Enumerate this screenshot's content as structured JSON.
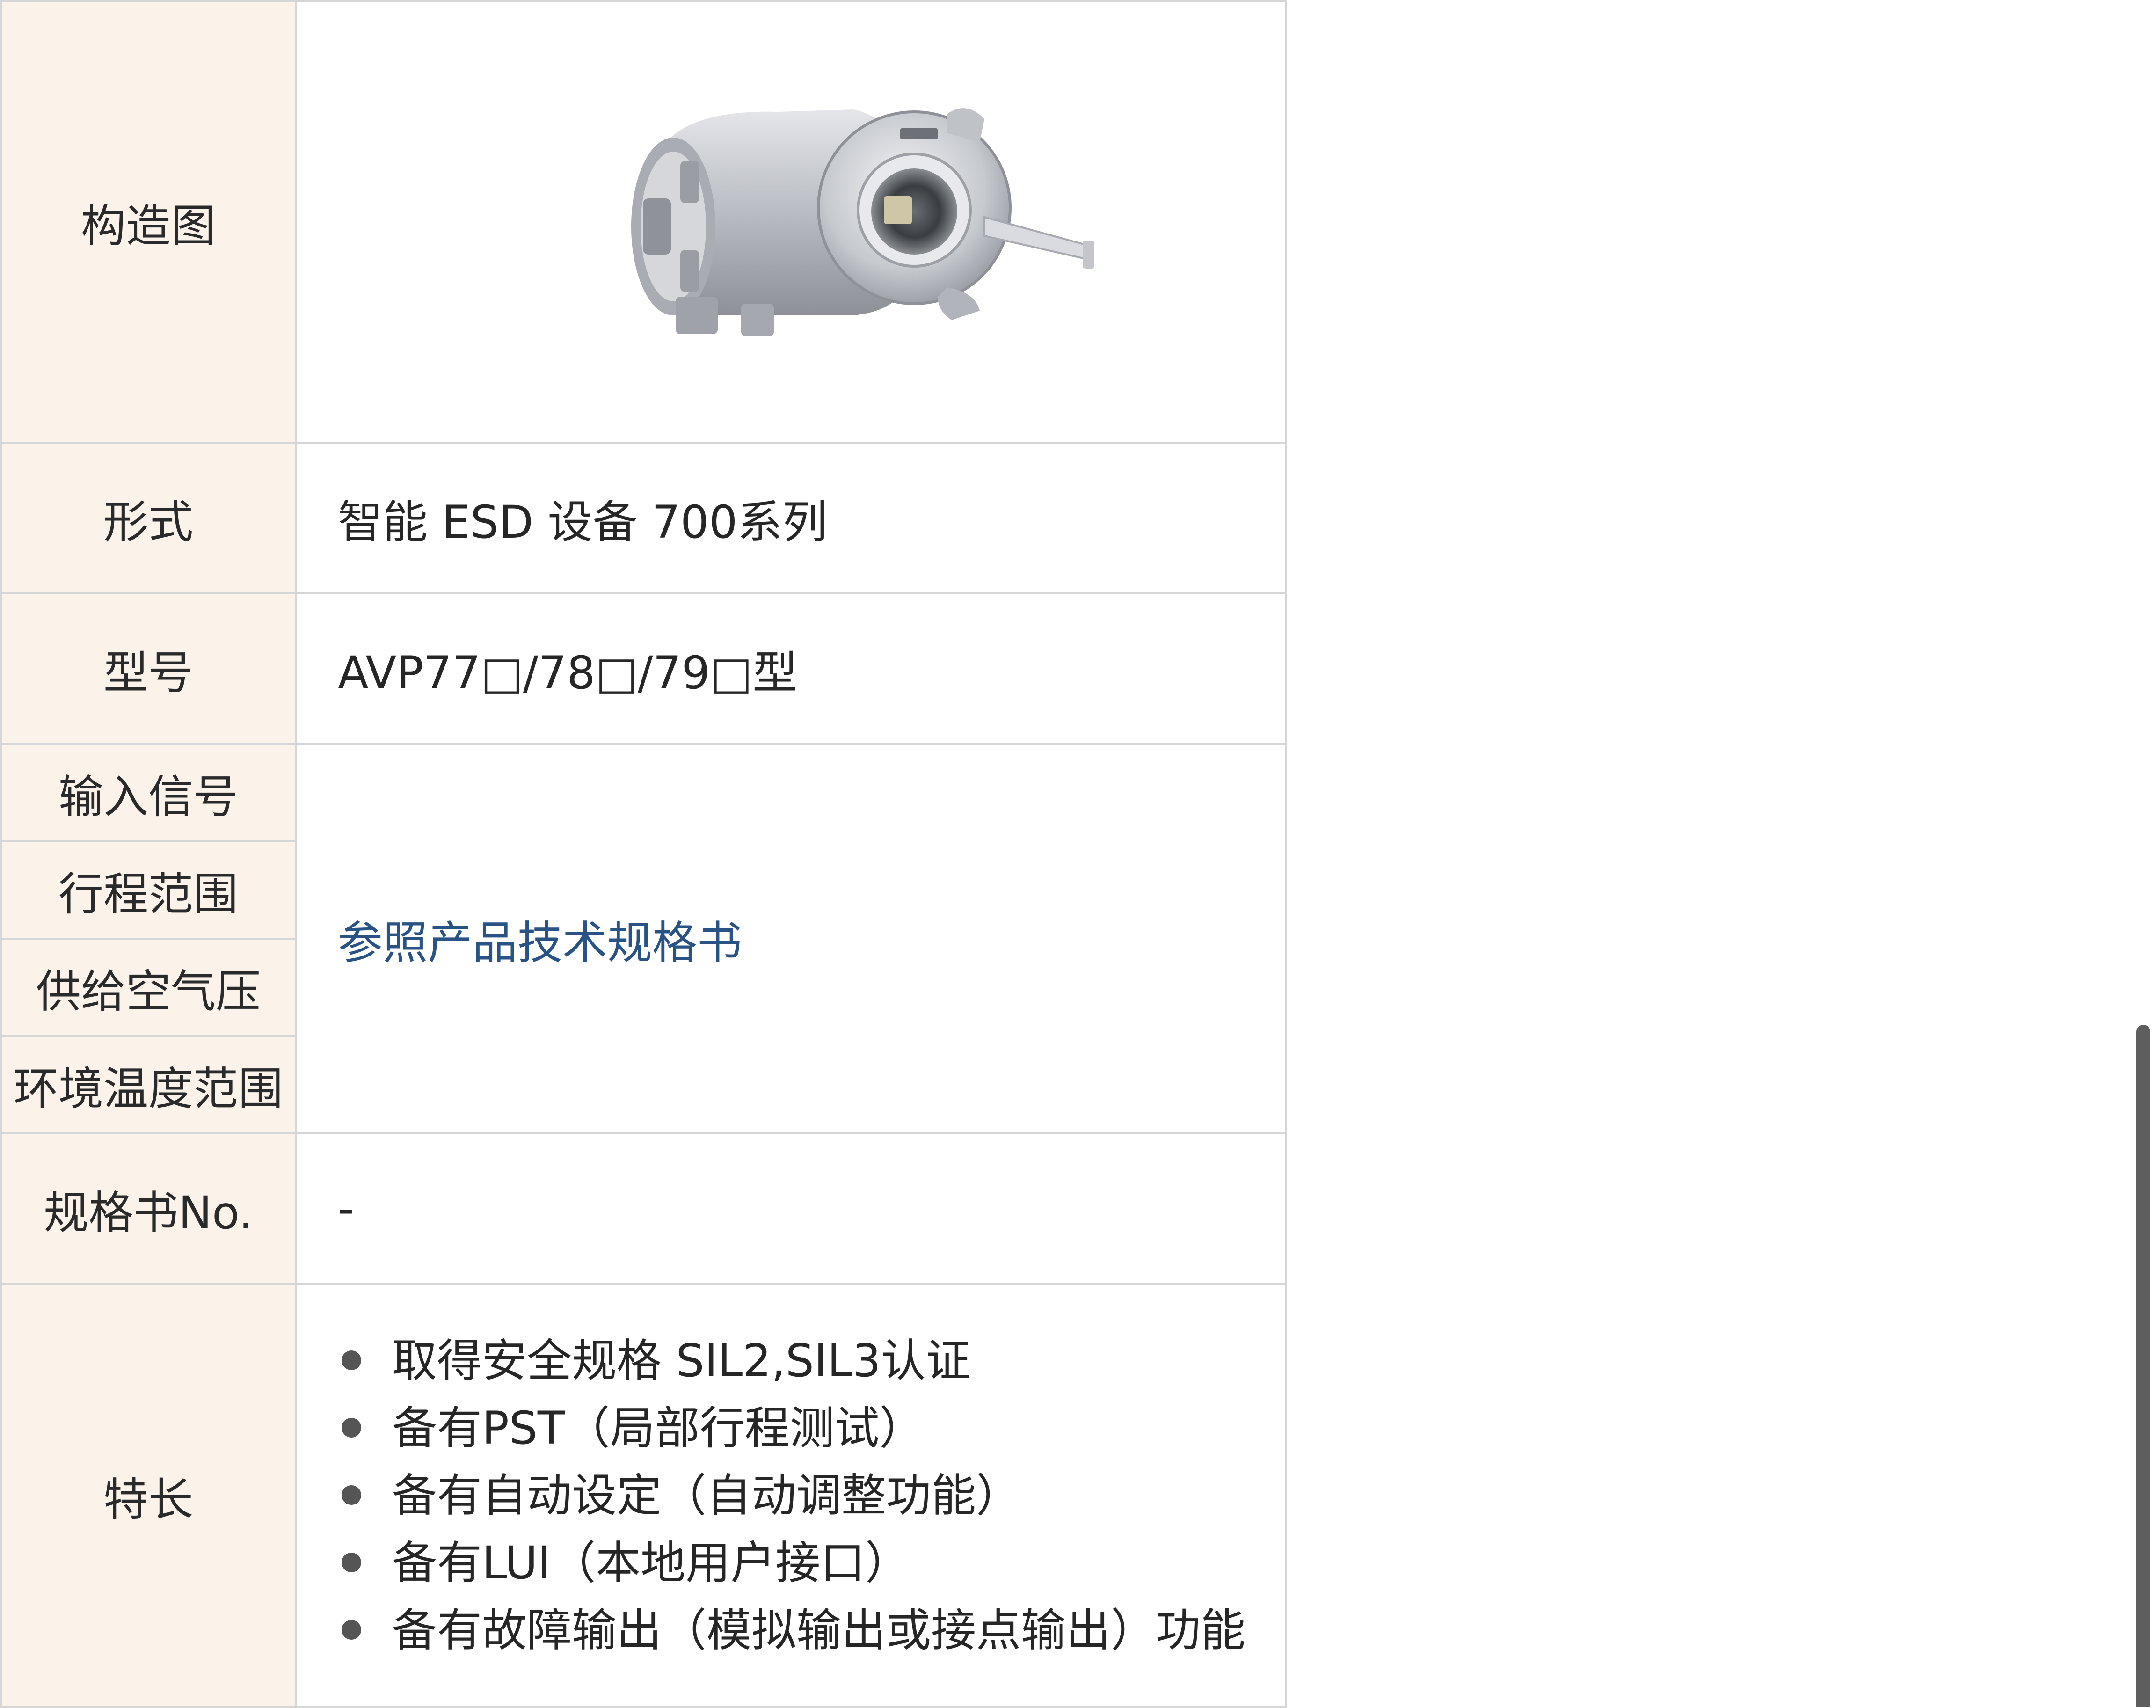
{
  "rows": {
    "structure": {
      "label": "构造图"
    },
    "form": {
      "label": "形式",
      "value": "智能 ESD 设备 700系列"
    },
    "model": {
      "label": "型号",
      "value": "AVP77□/78□/79□型"
    },
    "input_signal": {
      "label": "输入信号"
    },
    "stroke_range": {
      "label": "行程范围"
    },
    "supply_pressure": {
      "label": "供给空气压"
    },
    "ambient_temp": {
      "label": "环境温度范围"
    },
    "spec_link": {
      "value": "参照产品技术规格书"
    },
    "spec_no": {
      "label": "规格书No.",
      "value": "-"
    },
    "features": {
      "label": "特长",
      "items": [
        "取得安全规格 SIL2,SIL3认证",
        "备有PST（局部行程测试）",
        "备有自动设定（自动调整功能）",
        "备有LUI（本地用户接口）",
        "备有故障输出（模拟输出或接点输出）功能"
      ]
    }
  },
  "colors": {
    "label_bg": "#fbf3ea",
    "border": "#d6d6d6",
    "link": "#2a5385",
    "text": "#262626"
  }
}
